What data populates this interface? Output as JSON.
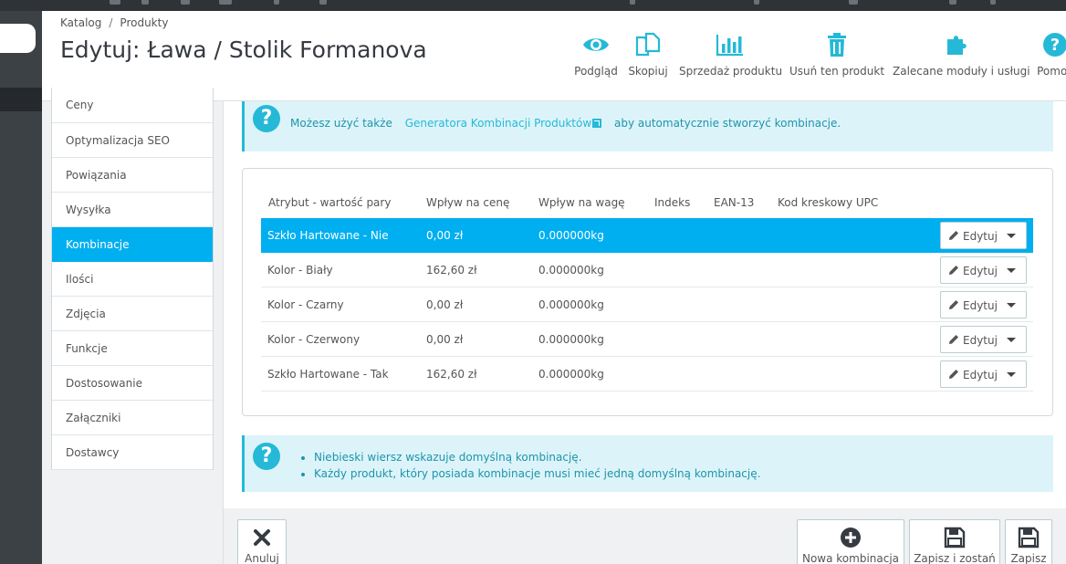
{
  "breadcrumb": {
    "items": [
      "Katalog",
      "Produkty"
    ],
    "separator": "/"
  },
  "page": {
    "title": "Edytuj: Ława / Stolik Formanova"
  },
  "toolbar": {
    "preview": "Podgląd",
    "duplicate": "Skopiuj",
    "sales": "Sprzedaż produktu",
    "delete": "Usuń ten produkt",
    "modules": "Zalecane moduły i usługi",
    "help": "Pomoc"
  },
  "colors": {
    "accent": "#25b9d7",
    "active_tab": "#00aff0",
    "alert_bg": "#dcf4f9",
    "sidebar": "#3c4146"
  },
  "tabs": [
    {
      "label": "Ceny"
    },
    {
      "label": "Optymalizacja SEO"
    },
    {
      "label": "Powiązania"
    },
    {
      "label": "Wysyłka"
    },
    {
      "label": "Kombinacje"
    },
    {
      "label": "Ilości"
    },
    {
      "label": "Zdjęcia"
    },
    {
      "label": "Funkcje"
    },
    {
      "label": "Dostosowanie"
    },
    {
      "label": "Załączniki"
    },
    {
      "label": "Dostawcy"
    }
  ],
  "alert_top": {
    "prefix": "Możesz użyć także",
    "link": "Generatora Kombinacji Produktów",
    "suffix": "aby automatycznie stworzyć kombinacje."
  },
  "table": {
    "headers": [
      "Atrybut - wartość pary",
      "Wpływ na cenę",
      "Wpływ na wagę",
      "Indeks",
      "EAN-13",
      "Kod kreskowy UPC"
    ],
    "rows": [
      {
        "attribute": "Szkło Hartowane - Nie",
        "price": "0,00 zł",
        "weight": "0.000000kg"
      },
      {
        "attribute": "Kolor - Biały",
        "price": "162,60 zł",
        "weight": "0.000000kg"
      },
      {
        "attribute": "Kolor - Czarny",
        "price": "0,00 zł",
        "weight": "0.000000kg"
      },
      {
        "attribute": "Kolor - Czerwony",
        "price": "0,00 zł",
        "weight": "0.000000kg"
      },
      {
        "attribute": "Szkło Hartowane - Tak",
        "price": "162,60 zł",
        "weight": "0.000000kg"
      }
    ],
    "edit_label": "Edytuj"
  },
  "alert_bottom": {
    "items": [
      "Niebieski wiersz wskazuje domyślną kombinację.",
      "Każdy produkt, który posiada kombinacje musi mieć jedną domyślną kombinację."
    ]
  },
  "footer": {
    "cancel": "Anuluj",
    "new_combination": "Nowa kombinacja",
    "save_stay": "Zapisz i zostań",
    "save": "Zapisz"
  }
}
